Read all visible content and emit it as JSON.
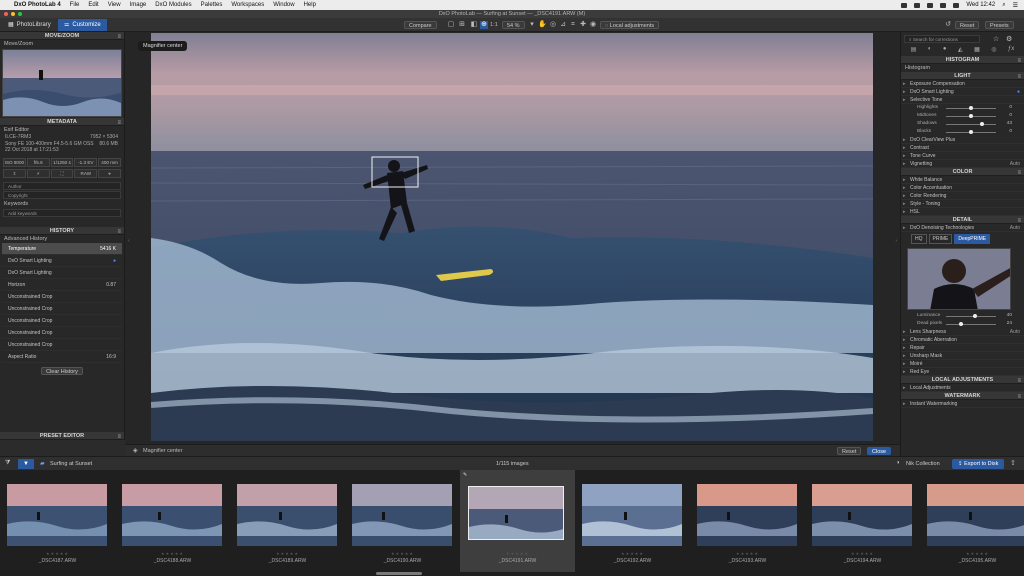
{
  "menubar": {
    "items": [
      "DxO PhotoLab 4",
      "File",
      "Edit",
      "View",
      "Image",
      "DxO Modules",
      "Palettes",
      "Workspaces",
      "Window",
      "Help"
    ],
    "clock": "Wed 12:42"
  },
  "window": {
    "title": "DxO PhotoLab — Surfing at Sunset — _DSC4191.ARW (M)"
  },
  "toolbar": {
    "tab_library": "PhotoLibrary",
    "tab_customize": "Customize",
    "compare": "Compare",
    "ratio": "1:1",
    "zoom": "54 %",
    "local_adjust": "Local adjustments",
    "reset": "Reset",
    "presets": "Presets"
  },
  "left": {
    "move_zoom": {
      "title": "MOVE/ZOOM",
      "sub": "Move/Zoom"
    },
    "metadata": {
      "title": "METADATA",
      "sub": "Exif Editor",
      "file_short": "ILCE-7RM3",
      "dims": "7952 × 5304",
      "lens": "Sony FE 100-400mm F4.5-5.6 GM OSS",
      "size": "80.6 MB",
      "date": "22 Oct 2018 at 17:21:53",
      "iso": "ISO 8000",
      "aperture": "f/5.6",
      "shutter": "1/1250 s",
      "ev": "-1.3 EV",
      "focal": "400 mm",
      "raw": "RAW",
      "author": "Author",
      "copyright": "Copyright",
      "keywords": "Keywords",
      "add_keyword": "Add keywords"
    },
    "history": {
      "title": "HISTORY",
      "sub": "Advanced History",
      "items": [
        {
          "label": "Temperature",
          "value": "5416 K"
        },
        {
          "label": "DxO Smart Lighting",
          "value": ""
        },
        {
          "label": "DxO Smart Lighting",
          "value": ""
        },
        {
          "label": "Horizon",
          "value": "0.87"
        },
        {
          "label": "Unconstrained Crop",
          "value": ""
        },
        {
          "label": "Unconstrained Crop",
          "value": ""
        },
        {
          "label": "Unconstrained Crop",
          "value": ""
        },
        {
          "label": "Unconstrained Crop",
          "value": ""
        },
        {
          "label": "Unconstrained Crop",
          "value": ""
        },
        {
          "label": "Aspect Ratio",
          "value": "16:9"
        }
      ],
      "clear": "Clear History"
    },
    "preset_editor": "PRESET EDITOR"
  },
  "viewer": {
    "magnifier_chip": "Magnifier center",
    "bottom_label": "Magnifier center",
    "reset": "Reset",
    "close": "Close"
  },
  "right": {
    "search_placeholder": "Search for corrections",
    "histogram": {
      "title": "HISTOGRAM",
      "sub": "Histogram"
    },
    "light": {
      "title": "LIGHT",
      "items": [
        "Exposure Compensation",
        "DxO Smart Lighting",
        "Selective Tone"
      ],
      "sliders": [
        {
          "label": "Highlights",
          "value": "0",
          "pos": 0.5
        },
        {
          "label": "Midtones",
          "value": "0",
          "pos": 0.5
        },
        {
          "label": "Shadows",
          "value": "43",
          "pos": 0.72
        },
        {
          "label": "Blacks",
          "value": "0",
          "pos": 0.5
        }
      ],
      "more": [
        "DxO ClearView Plus",
        "Contrast",
        "Tone Curve",
        "Vignetting"
      ],
      "vignette_auto": "Auto"
    },
    "color": {
      "title": "COLOR",
      "items": [
        "White Balance",
        "Color Accentuation",
        "Color Rendering",
        "Style - Toning",
        "HSL"
      ]
    },
    "detail": {
      "title": "DETAIL",
      "denoise": "DxO Denoising Technologies",
      "denoise_auto": "Auto",
      "modes": [
        "HQ",
        "PRIME",
        "DeepPRIME"
      ],
      "lum_label": "Luminance",
      "lum_value": "40",
      "dead_label": "Dead pixels",
      "dead_value": "24",
      "items": [
        "Lens Sharpness",
        "Chromatic Aberration",
        "Repair",
        "Unsharp Mask",
        "Moiré",
        "Red Eye"
      ],
      "lens_auto": "Auto"
    },
    "local": {
      "title": "LOCAL ADJUSTMENTS",
      "item": "Local Adjustments"
    },
    "watermark": {
      "title": "WATERMARK",
      "item": "Instant Watermarking"
    }
  },
  "filmstrip": {
    "folder": "Surfing at Sunset",
    "count": "1/115 images",
    "nik": "Nik Collection",
    "export": "Export to Disk",
    "thumbs": [
      "_DSC4187.ARW",
      "_DSC4188.ARW",
      "_DSC4189.ARW",
      "_DSC4190.ARW",
      "_DSC4191.ARW",
      "_DSC4192.ARW",
      "_DSC4193.ARW",
      "_DSC4194.ARW",
      "_DSC4195.ARW"
    ]
  }
}
